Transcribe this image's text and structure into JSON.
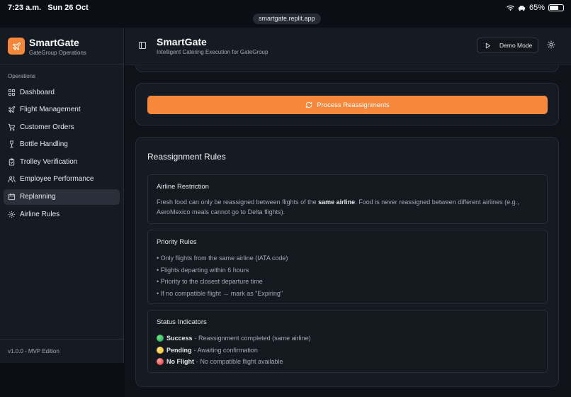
{
  "status_bar": {
    "time": "7:23 a.m.",
    "date": "Sun 26 Oct",
    "battery": "65%"
  },
  "browser": {
    "url": "smartgate.replit.app"
  },
  "sidebar": {
    "brand_title": "SmartGate",
    "brand_subtitle": "GateGroup Operations",
    "section_label": "Operations",
    "items": [
      {
        "label": "Dashboard",
        "icon": "dashboard-icon",
        "active": false
      },
      {
        "label": "Flight Management",
        "icon": "plane-icon",
        "active": false
      },
      {
        "label": "Customer Orders",
        "icon": "cart-icon",
        "active": false
      },
      {
        "label": "Bottle Handling",
        "icon": "wine-icon",
        "active": false
      },
      {
        "label": "Trolley Verification",
        "icon": "clipboard-check-icon",
        "active": false
      },
      {
        "label": "Employee Performance",
        "icon": "users-icon",
        "active": false
      },
      {
        "label": "Replanning",
        "icon": "calendar-icon",
        "active": true
      },
      {
        "label": "Airline Rules",
        "icon": "gear-icon",
        "active": false
      }
    ],
    "version": "v1.0.0 - MVP Edition"
  },
  "header": {
    "title": "SmartGate",
    "subtitle": "Intelligent Catering Execution for GateGroup",
    "demo_label": "Demo Mode"
  },
  "main": {
    "process_button": "Process Reassignments",
    "rules_title": "Reassignment Rules",
    "airline_restriction": {
      "title": "Airline Restriction",
      "text_before": "Fresh food can only be reassigned between flights of the ",
      "text_bold": "same airline",
      "text_after": ". Food is never reassigned between different airlines (e.g., AeroMexico meals cannot go to Delta flights)."
    },
    "priority_rules": {
      "title": "Priority Rules",
      "items": [
        "• Only flights from the same airline (IATA code)",
        "• Flights departing within 6 hours",
        "• Priority to the closest departure time",
        "• If no compatible flight → mark as \"Expiring\""
      ]
    },
    "status_indicators": {
      "title": "Status Indicators",
      "items": [
        {
          "label": "Success",
          "text": "- Reassignment completed (same airline)",
          "color": "#22c55e"
        },
        {
          "label": "Pending",
          "text": "- Awaiting confirmation",
          "color": "#facc15"
        },
        {
          "label": "No Flight",
          "text": "- No compatible flight available",
          "color": "#ef4444"
        }
      ]
    }
  },
  "colors": {
    "accent": "#f7873a",
    "background": "#0f1218",
    "panel": "#161a22"
  }
}
